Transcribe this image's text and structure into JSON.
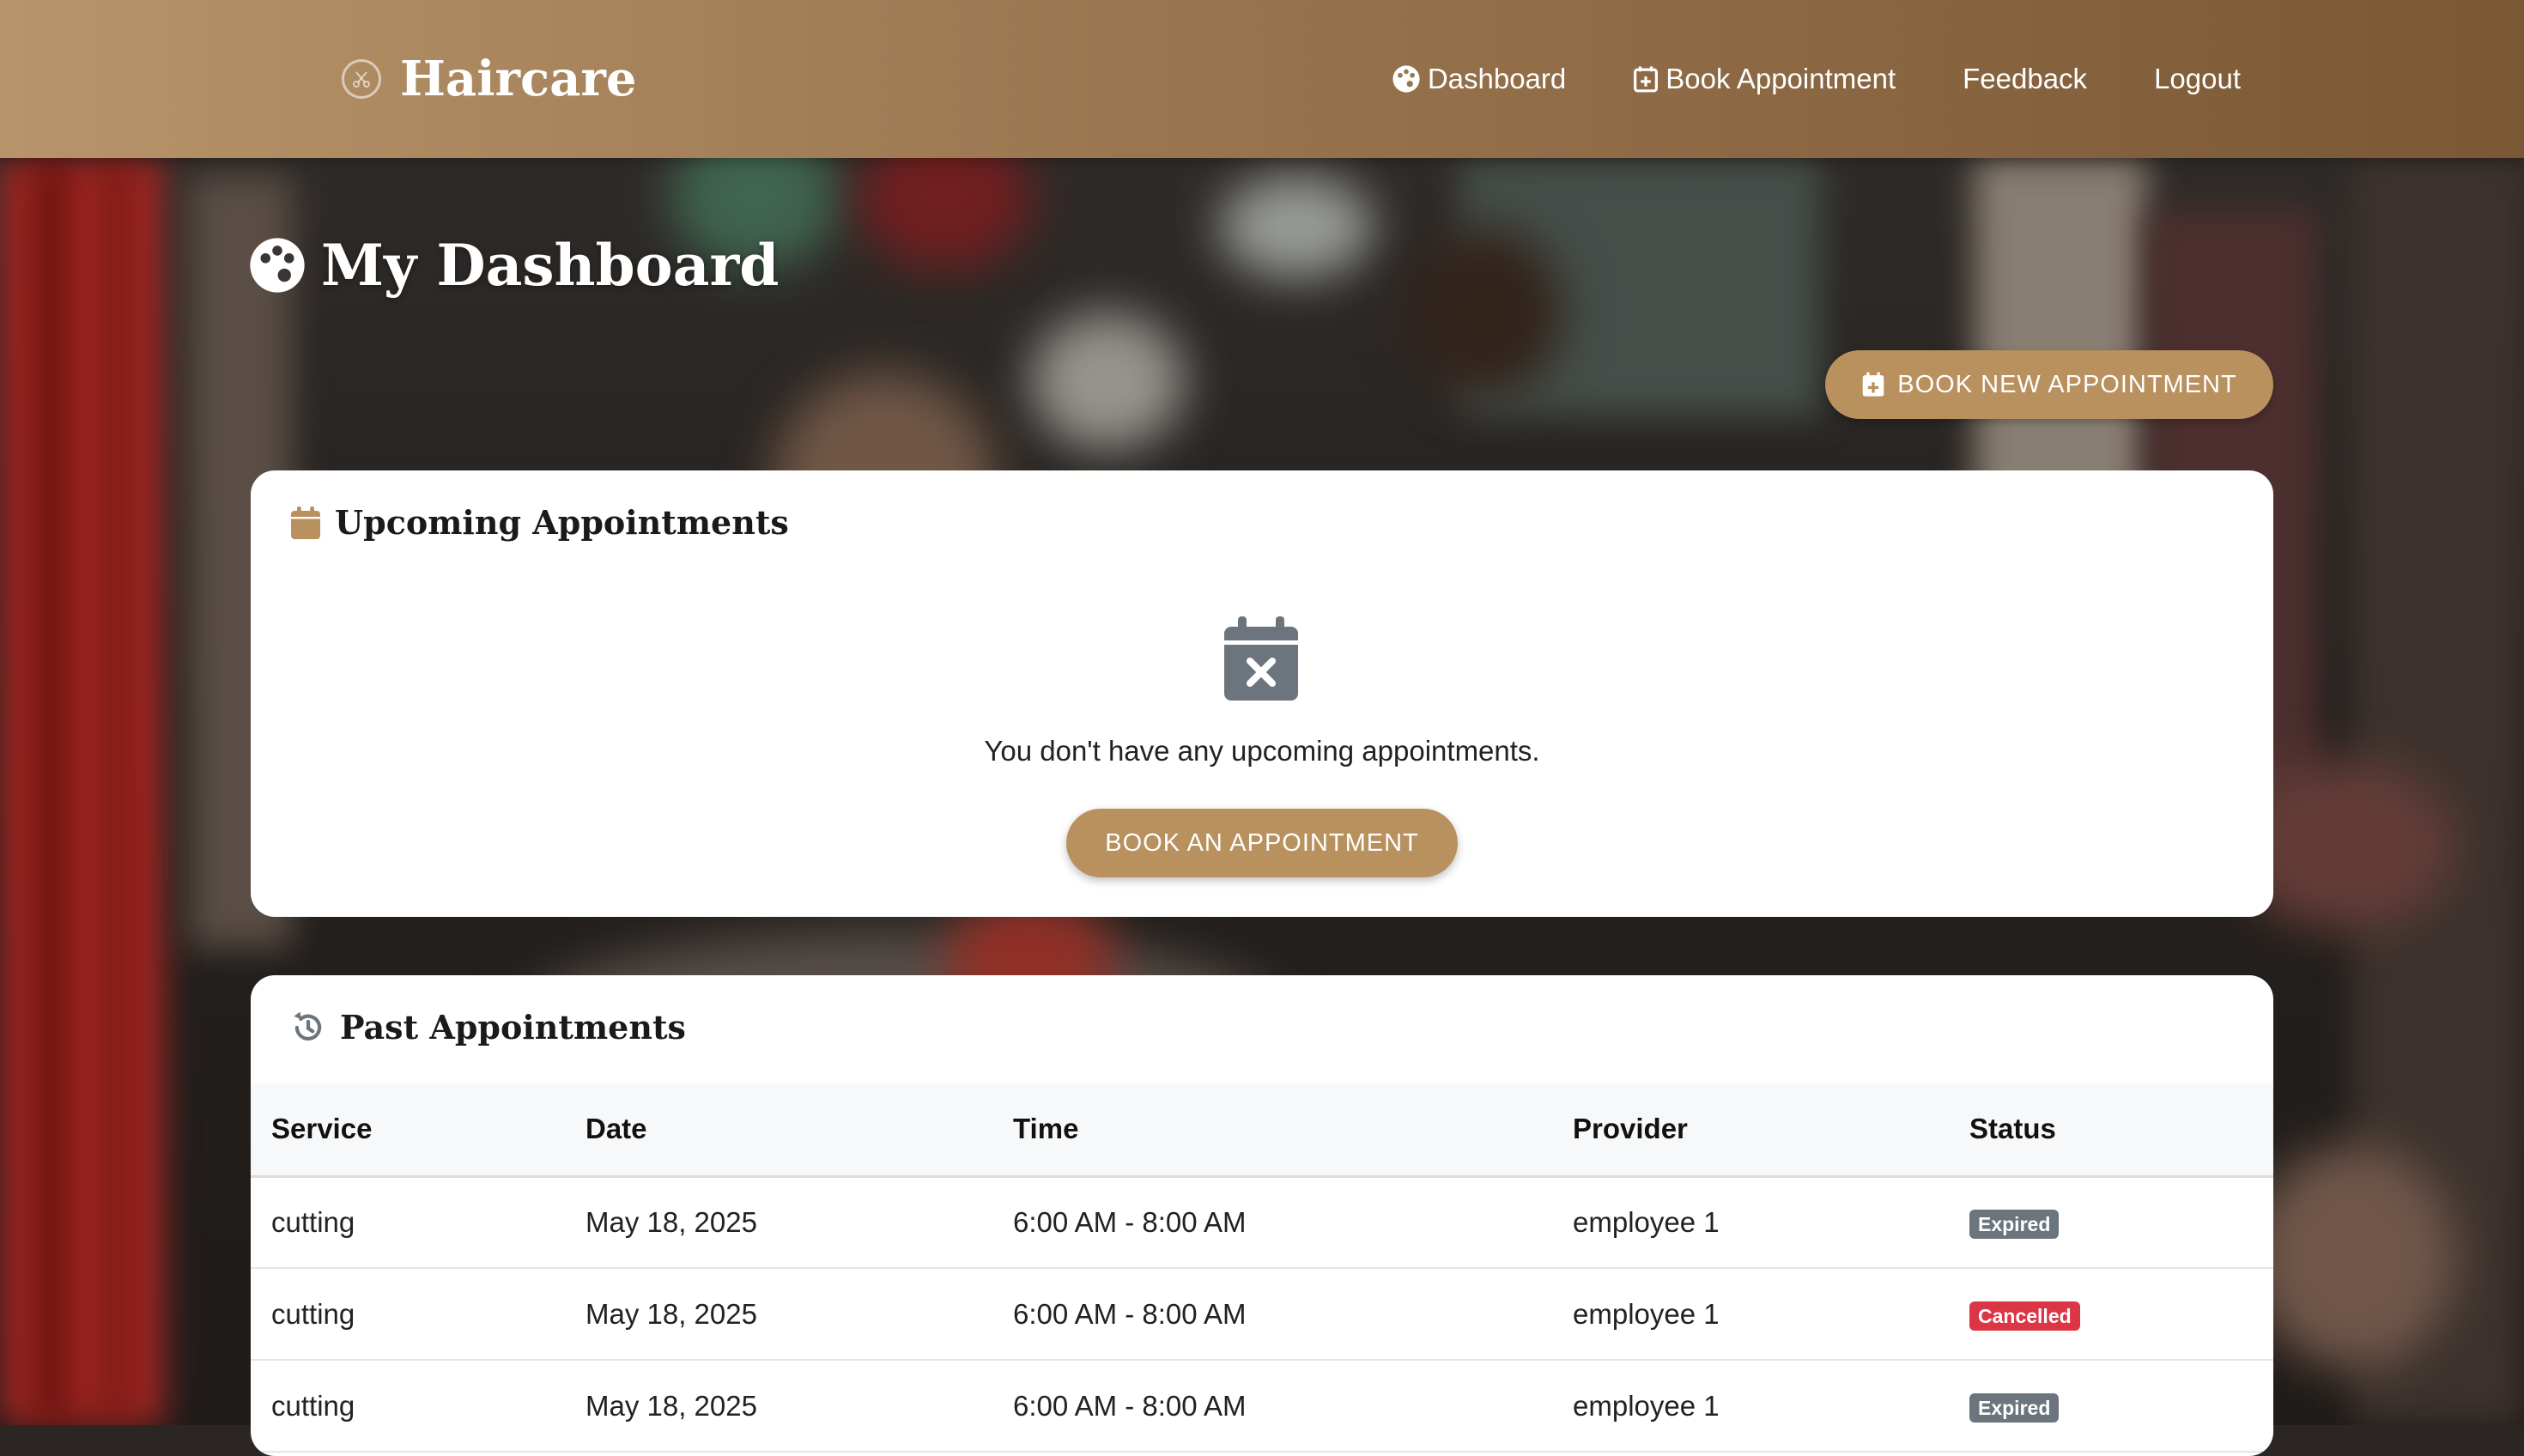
{
  "app": {
    "brand": "Haircare"
  },
  "nav": {
    "items": [
      {
        "label": "Dashboard",
        "icon": "palette-icon"
      },
      {
        "label": "Book Appointment",
        "icon": "calendar-plus-icon"
      },
      {
        "label": "Feedback",
        "icon": ""
      },
      {
        "label": "Logout",
        "icon": ""
      }
    ]
  },
  "page": {
    "title": "My Dashboard",
    "new_button_label": "BOOK NEW APPOINTMENT"
  },
  "upcoming": {
    "title": "Upcoming Appointments",
    "empty_text": "You don't have any upcoming appointments.",
    "button_label": "BOOK AN APPOINTMENT"
  },
  "past": {
    "title": "Past Appointments",
    "columns": [
      "Service",
      "Date",
      "Time",
      "Provider",
      "Status"
    ],
    "rows": [
      {
        "service": "cutting",
        "date": "May 18, 2025",
        "time": "6:00 AM - 8:00 AM",
        "provider": "employee 1",
        "status": "Expired"
      },
      {
        "service": "cutting",
        "date": "May 18, 2025",
        "time": "6:00 AM - 8:00 AM",
        "provider": "employee 1",
        "status": "Cancelled"
      },
      {
        "service": "cutting",
        "date": "May 18, 2025",
        "time": "6:00 AM - 8:00 AM",
        "provider": "employee 1",
        "status": "Expired"
      }
    ]
  },
  "colors": {
    "accent": "#b8915e",
    "header_start": "#b8946a",
    "header_end": "#7a5834",
    "status_expired": "#6c757d",
    "status_cancelled": "#dc3545",
    "icon_muted": "#6c757d"
  }
}
